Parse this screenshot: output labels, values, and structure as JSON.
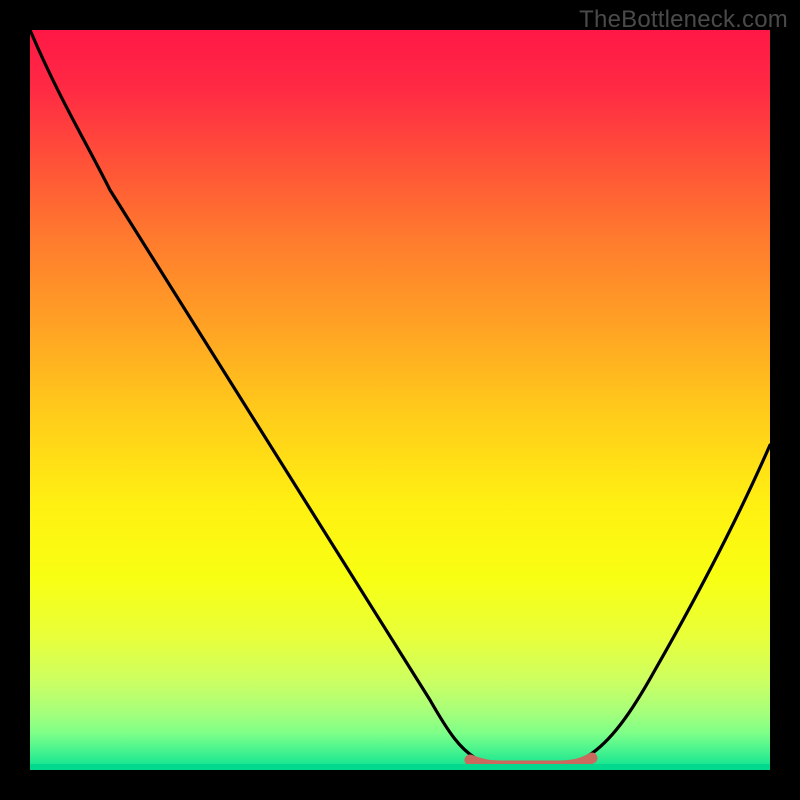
{
  "watermark": "TheBottleneck.com",
  "chart_data": {
    "type": "line",
    "title": "",
    "xlabel": "",
    "ylabel": "",
    "xlim": [
      0,
      100
    ],
    "ylim": [
      0,
      100
    ],
    "grid": false,
    "legend": false,
    "annotations": [
      {
        "text": "TheBottleneck.com",
        "position": "top-right"
      }
    ],
    "series": [
      {
        "name": "bottleneck-curve",
        "x": [
          0,
          5,
          10,
          15,
          20,
          25,
          30,
          35,
          40,
          45,
          50,
          55,
          58,
          60,
          63,
          66,
          70,
          72,
          76,
          80,
          85,
          90,
          95,
          100
        ],
        "values": [
          100,
          92,
          83,
          74,
          65,
          56,
          47,
          38,
          30,
          22,
          14,
          7,
          3,
          1,
          0,
          0,
          0,
          1,
          3,
          7,
          14,
          23,
          33,
          45
        ]
      },
      {
        "name": "optimal-band",
        "x": [
          58,
          60,
          63,
          66,
          70,
          72
        ],
        "values": [
          1,
          0.5,
          0,
          0,
          0.5,
          1
        ]
      }
    ],
    "colors": {
      "curve": "#000000",
      "optimal_band": "#c96a5e",
      "gradient_top": "#ff1846",
      "gradient_bottom": "#02d88e"
    }
  }
}
